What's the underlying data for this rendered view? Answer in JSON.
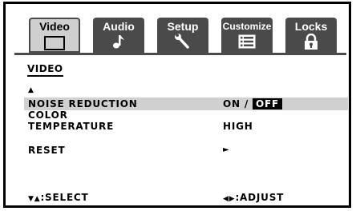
{
  "tabs": [
    {
      "label": "Video",
      "icon": "screen-icon",
      "active": true
    },
    {
      "label": "Audio",
      "icon": "music-note-icon",
      "active": false
    },
    {
      "label": "Setup",
      "icon": "wrench-icon",
      "active": false
    },
    {
      "label": "Customize",
      "icon": "list-icon",
      "active": false
    },
    {
      "label": "Locks",
      "icon": "padlock-icon",
      "active": false
    }
  ],
  "menu": {
    "title": "VIDEO",
    "scroll_up": "▲",
    "items": [
      {
        "label": "NOISE REDUCTION",
        "value_on": "ON",
        "separator": "/",
        "value_off": "OFF",
        "highlighted": true
      },
      {
        "label_line1": "COLOR",
        "label_line2": "TEMPERATURE",
        "value": "HIGH"
      },
      {
        "label": "RESET",
        "value": "►"
      }
    ]
  },
  "footer": {
    "select_glyph": "▼▲",
    "select_label": ":SELECT",
    "adjust_glyph": "◀▶",
    "adjust_label": ":ADJUST"
  },
  "colors": {
    "tab_bg": "#4a4a4a",
    "tab_active_bg": "#cfcfcf",
    "highlight": "#d0d0d0"
  }
}
